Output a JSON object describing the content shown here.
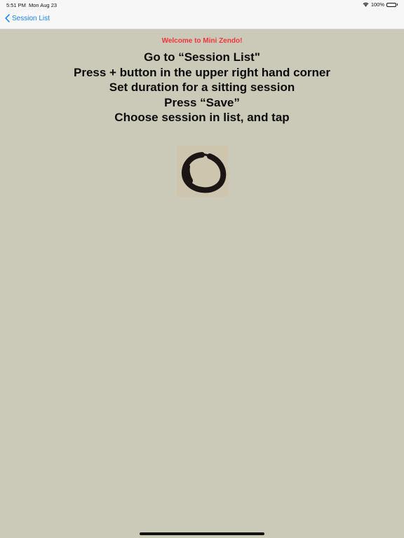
{
  "status_bar": {
    "time": "5:51 PM",
    "date": "Mon Aug 23",
    "battery": "100%"
  },
  "nav": {
    "back_label": "Session List"
  },
  "main": {
    "welcome": "Welcome to Mini Zendo!",
    "instructions": [
      "Go to “Session List\"",
      "Press + button in the upper right hand corner",
      "Set duration for a sitting session",
      "Press “Save”",
      "Choose session in list, and tap"
    ]
  },
  "colors": {
    "background": "#cbcab8",
    "accent": "#1a7ef5",
    "welcome": "#f0343c"
  },
  "icons": {
    "back": "chevron-left-icon",
    "wifi": "wifi-icon",
    "battery": "battery-icon",
    "logo": "enso-icon"
  }
}
